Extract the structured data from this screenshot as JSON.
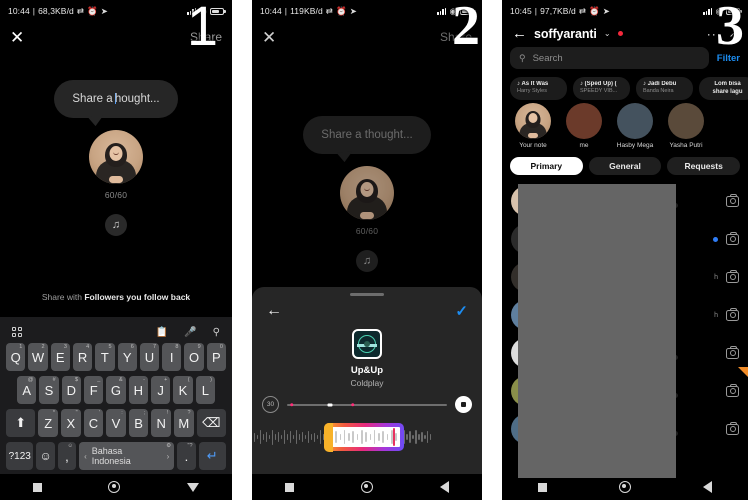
{
  "panels": [
    {
      "number": "1",
      "status": {
        "time": "10:44",
        "data_rate": "68,3KB/d",
        "icons": [
          "sync-icon",
          "alarm-icon",
          "location-icon",
          "signal-icon",
          "wifi-icon",
          "battery-icon"
        ]
      },
      "nav": {
        "close": "✕",
        "share": "Share"
      },
      "note": {
        "placeholder_before": "Share a ",
        "placeholder_after": "hought...",
        "full_text": "Share a thought...",
        "char_count": "60/60",
        "music_icon": "music-note-icon"
      },
      "share_with_prefix": "Share with ",
      "share_with_target": "Followers you follow back",
      "keyboard": {
        "toolbar_icons": [
          "grid-icon",
          "clipboard-icon",
          "microphone-icon",
          "search-icon"
        ],
        "row1": [
          {
            "key": "Q",
            "sup": "1"
          },
          {
            "key": "W",
            "sup": "2"
          },
          {
            "key": "E",
            "sup": "3"
          },
          {
            "key": "R",
            "sup": "4"
          },
          {
            "key": "T",
            "sup": "5"
          },
          {
            "key": "Y",
            "sup": "6"
          },
          {
            "key": "U",
            "sup": "7"
          },
          {
            "key": "I",
            "sup": "8"
          },
          {
            "key": "O",
            "sup": "9"
          },
          {
            "key": "P",
            "sup": "0"
          }
        ],
        "row2": [
          {
            "key": "A",
            "sup": "@"
          },
          {
            "key": "S",
            "sup": "#"
          },
          {
            "key": "D",
            "sup": "$"
          },
          {
            "key": "F",
            "sup": "_"
          },
          {
            "key": "G",
            "sup": "&"
          },
          {
            "key": "H",
            "sup": "-"
          },
          {
            "key": "J",
            "sup": "+"
          },
          {
            "key": "K",
            "sup": "("
          },
          {
            "key": "L",
            "sup": ")"
          }
        ],
        "row3": [
          {
            "key": "⬆",
            "sup": ""
          },
          {
            "key": "Z",
            "sup": "*"
          },
          {
            "key": "X",
            "sup": "\""
          },
          {
            "key": "C",
            "sup": "'"
          },
          {
            "key": "V",
            "sup": ":"
          },
          {
            "key": "B",
            "sup": ";"
          },
          {
            "key": "N",
            "sup": "!"
          },
          {
            "key": "M",
            "sup": "?"
          },
          {
            "key": "⌫",
            "sup": ""
          }
        ],
        "row4": {
          "symbols": "?123",
          "emoji": "☺",
          "comma": ",",
          "comma_sup": "☺",
          "space_label": "Bahasa Indonesia",
          "space_sup": "⚙",
          "period": ".",
          "period_sup": "\"?",
          "enter": "↵"
        }
      },
      "navbar": [
        "recents-square-icon",
        "home-circle-icon",
        "back-triangle-icon"
      ]
    },
    {
      "number": "2",
      "status": {
        "time": "10:44",
        "data_rate": "119KB/d"
      },
      "nav": {
        "close": "✕",
        "share": "Share"
      },
      "note": {
        "full_text": "Share a thought...",
        "char_count": "60/60",
        "music_icon": "music-note-icon"
      },
      "music_sheet": {
        "back": "←",
        "confirm": "✓",
        "song_title": "Up&Up",
        "artist": "Coldplay",
        "duration": "30",
        "record_icon": "stop-record-icon"
      },
      "navbar": [
        "recents-square-icon",
        "home-circle-icon",
        "back-triangle-icon"
      ]
    },
    {
      "number": "3",
      "status": {
        "time": "10:45",
        "data_rate": "97,7KB/d"
      },
      "header": {
        "back": "←",
        "username": "soffyaranti",
        "chevron": "⌄",
        "has_unread_dot": true,
        "more": "···",
        "trend_icon": "trending-arrow-icon"
      },
      "search": {
        "placeholder": "Search",
        "icon": "search-icon",
        "filter_label": "Filter"
      },
      "music_notes": [
        {
          "title": "As It Was",
          "subtitle": "Harry Styles",
          "has_music_icon": true
        },
        {
          "title": "(Sped Up) (",
          "subtitle": "SPEEDY VIB...",
          "has_music_icon": true
        },
        {
          "title": "Jadi Debu",
          "subtitle": "Banda Neira",
          "has_music_icon": true
        },
        {
          "title": "Lom bisa share lagu",
          "subtitle": "",
          "has_music_icon": false
        }
      ],
      "stories": [
        {
          "name": "Your note"
        },
        {
          "name": "me"
        },
        {
          "name": "Hasby Mega"
        },
        {
          "name": "Yasha Putri"
        }
      ],
      "tabs": [
        {
          "label": "Primary",
          "active": true
        },
        {
          "label": "General",
          "active": false
        },
        {
          "label": "Requests",
          "active": false
        }
      ],
      "messages": [
        {
          "time": "",
          "unread": false,
          "camera": true
        },
        {
          "time": "",
          "unread": true,
          "camera": true
        },
        {
          "time": "h",
          "unread": false,
          "camera": true
        },
        {
          "time": "h",
          "unread": false,
          "camera": true
        },
        {
          "time": "",
          "unread": false,
          "camera": true
        },
        {
          "time": "",
          "unread": false,
          "camera": true
        },
        {
          "time": "",
          "unread": false,
          "camera": true
        }
      ],
      "navbar": [
        "recents-square-icon",
        "home-circle-icon",
        "back-triangle-icon"
      ]
    }
  ],
  "colors": {
    "background": "#000000",
    "accent_blue": "#1c8cf0",
    "unread_blue": "#2f7df6",
    "red_dot": "#f5293c",
    "keyboard_bg": "#1c1c1e",
    "key_bg": "#545558",
    "sheet_bg": "#262626",
    "redaction_gray": "#656565",
    "orange": "#f28c28"
  }
}
